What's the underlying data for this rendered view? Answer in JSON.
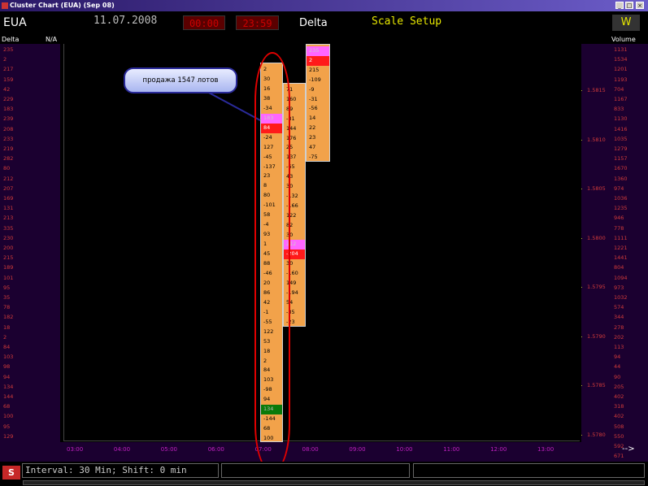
{
  "window": {
    "title": "Cluster Chart (EUA) (Sep 08)",
    "buttons": [
      "_",
      "□",
      "×"
    ]
  },
  "header": {
    "symbol": "EUA",
    "date": "11.07.2008",
    "time_start": "00:00",
    "time_end": "23:59",
    "mode": "Delta",
    "scale_setup": "Scale Setup",
    "w_button": "W"
  },
  "left_header": {
    "delta": "Delta",
    "na": "N/A"
  },
  "right_header": {
    "volume": "Volume"
  },
  "left_values": [
    "235",
    "2",
    "217",
    "159",
    "42",
    "229",
    "183",
    "239",
    "208",
    "233",
    "219",
    "282",
    "80",
    "212",
    "207",
    "169",
    "131",
    "213",
    "335",
    "230",
    "200",
    "215",
    "189",
    "101",
    "95",
    "35",
    "78",
    "182",
    "18",
    "2",
    "84",
    "103",
    "98",
    "94",
    "134",
    "144",
    "68",
    "100",
    "95",
    "129"
  ],
  "right_values": [
    "1131",
    "1534",
    "1201",
    "1193",
    "704",
    "1167",
    "833",
    "1130",
    "1416",
    "1035",
    "1279",
    "1157",
    "1670",
    "1360",
    "974",
    "1036",
    "1235",
    "946",
    "778",
    "1111",
    "1221",
    "1441",
    "804",
    "1094",
    "973",
    "1032",
    "574",
    "344",
    "278",
    "202",
    "113",
    "94",
    "44",
    "90",
    "205",
    "402",
    "318",
    "402",
    "508",
    "550",
    "592",
    "671"
  ],
  "price_labels": [
    "1.5815",
    "1.5810",
    "1.5805",
    "1.5800",
    "1.5795",
    "1.5790",
    "1.5785",
    "1.5780"
  ],
  "x_labels": [
    "03:00",
    "04:00",
    "05:00",
    "06:00",
    "07:00",
    "08:00",
    "09:00",
    "10:00",
    "11:00",
    "12:00",
    "13:00"
  ],
  "arrow_label": "-->",
  "columns": [
    {
      "name": "col-0700",
      "cells": [
        "2",
        "30",
        "16",
        "38",
        "-34",
        "183",
        "84",
        "-24",
        "127",
        "-45",
        "-137",
        "23",
        "8",
        "80",
        "-101",
        "58",
        "-4",
        "93",
        "1",
        "45",
        "88",
        "-46",
        "20",
        "86",
        "42",
        "-1",
        "-55",
        "122",
        "53",
        "18",
        "2",
        "84",
        "103",
        "-98",
        "94",
        "134",
        "-144",
        "68",
        "100"
      ]
    },
    {
      "name": "col-0730",
      "cells": [
        "71",
        "160",
        "89",
        "-81",
        "144",
        "176",
        "25",
        "137",
        "-65",
        "43",
        "30",
        "-132",
        "-166",
        "122",
        "82",
        "30",
        "212",
        "-204",
        "30",
        "-160",
        "149",
        "-194",
        "54",
        "-35",
        "-23"
      ]
    },
    {
      "name": "col-0800",
      "cells": [
        "235",
        "2",
        "215",
        "-109",
        "-9",
        "-31",
        "-56",
        "14",
        "22",
        "23",
        "47",
        "-75"
      ]
    }
  ],
  "highlights": {
    "col-0700": {
      "5": "pink",
      "6": "red",
      "35": "green"
    },
    "col-0730": {
      "16": "pink",
      "17": "red"
    },
    "col-0800": {
      "0": "pink",
      "1": "red"
    }
  },
  "callout": {
    "text": "продажа 1547 лотов"
  },
  "status": {
    "interval_text": "Interval: 30 Min; Shift: 0 min",
    "s_button": "S"
  }
}
